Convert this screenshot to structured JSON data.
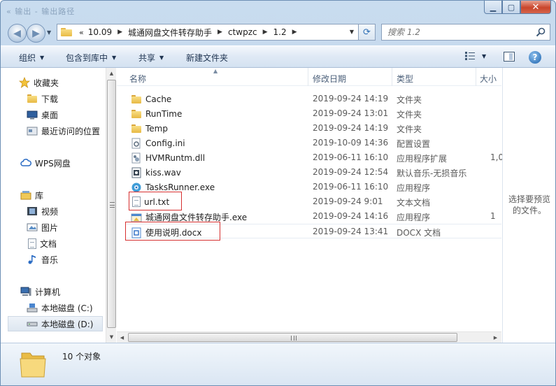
{
  "window": {
    "title": "« 输出 - 输出路径"
  },
  "address": {
    "lead": "«",
    "crumbs": [
      "10.09",
      "城通网盘文件转存助手",
      "ctwpzc",
      "1.2"
    ]
  },
  "search": {
    "placeholder": "搜索 1.2"
  },
  "toolbar": {
    "organize": "组织",
    "include_in_library": "包含到库中",
    "share": "共享",
    "new_folder": "新建文件夹"
  },
  "nav": {
    "favorites": "收藏夹",
    "downloads": "下载",
    "desktop": "桌面",
    "recent": "最近访问的位置",
    "wps": "WPS网盘",
    "libraries": "库",
    "videos": "视频",
    "pictures": "图片",
    "documents": "文档",
    "music": "音乐",
    "computer": "计算机",
    "drive_c": "本地磁盘 (C:)",
    "drive_d": "本地磁盘 (D:)"
  },
  "columns": {
    "name": "名称",
    "date": "修改日期",
    "type": "类型",
    "size": "大小"
  },
  "files": [
    {
      "name": "Cache",
      "date": "2019-09-24 14:19",
      "type": "文件夹",
      "size": "",
      "icon": "folder-icon"
    },
    {
      "name": "RunTime",
      "date": "2019-09-24 13:01",
      "type": "文件夹",
      "size": "",
      "icon": "folder-icon"
    },
    {
      "name": "Temp",
      "date": "2019-09-24 14:19",
      "type": "文件夹",
      "size": "",
      "icon": "folder-icon"
    },
    {
      "name": "Config.ini",
      "date": "2019-10-09 14:36",
      "type": "配置设置",
      "size": "",
      "icon": "config-file-icon"
    },
    {
      "name": "HVMRuntm.dll",
      "date": "2019-06-11 16:10",
      "type": "应用程序扩展",
      "size": "1,0",
      "icon": "dll-file-icon"
    },
    {
      "name": "kiss.wav",
      "date": "2019-09-24 12:54",
      "type": "默认音乐-无损音乐",
      "size": "",
      "icon": "audio-file-icon"
    },
    {
      "name": "TasksRunner.exe",
      "date": "2019-06-11 16:10",
      "type": "应用程序",
      "size": "",
      "icon": "exe-gear-icon"
    },
    {
      "name": "url.txt",
      "date": "2019-09-24 9:01",
      "type": "文本文档",
      "size": "",
      "icon": "text-file-icon"
    },
    {
      "name": "城通网盘文件转存助手.exe",
      "date": "2019-09-24 14:16",
      "type": "应用程序",
      "size": "1",
      "icon": "exe-app-icon"
    },
    {
      "name": "使用说明.docx",
      "date": "2019-09-24 13:41",
      "type": "DOCX 文档",
      "size": "",
      "icon": "docx-file-icon"
    }
  ],
  "preview": {
    "message": "选择要预览的文件。"
  },
  "status": {
    "count": "10 个对象"
  },
  "colors": {
    "highlight_box": "#d63030",
    "accent": "#1b62ad"
  }
}
